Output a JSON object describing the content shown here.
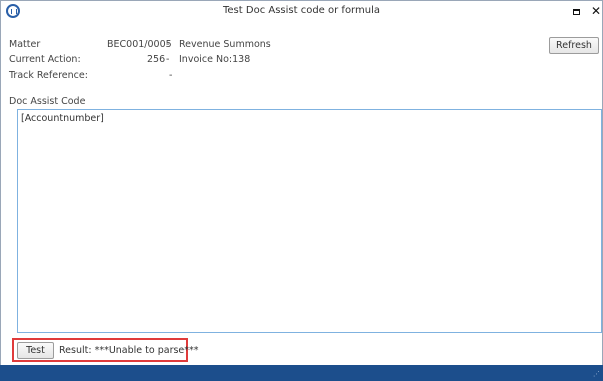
{
  "window": {
    "title": "Test Doc Assist code or formula",
    "maximize_icon": "maximize-icon",
    "close_glyph": "✕"
  },
  "fields": {
    "matter_label": "Matter",
    "matter_code": "BEC001/0005",
    "matter_sep": "-",
    "matter_desc": "Revenue Summons",
    "action_label": "Current Action:",
    "action_num": "256",
    "action_sep": "-",
    "action_desc": "Invoice No:138",
    "track_label": "Track Reference:",
    "track_value": "-"
  },
  "toolbar": {
    "refresh_label": "Refresh"
  },
  "code": {
    "label": "Doc Assist Code",
    "value": "[Accountnumber]"
  },
  "test": {
    "button_label": "Test",
    "result_text": "Result: ***Unable to parse***"
  },
  "colors": {
    "accent_border": "#7fb2e0",
    "highlight": "#e03b3b",
    "statusbar": "#1c4e8c"
  }
}
